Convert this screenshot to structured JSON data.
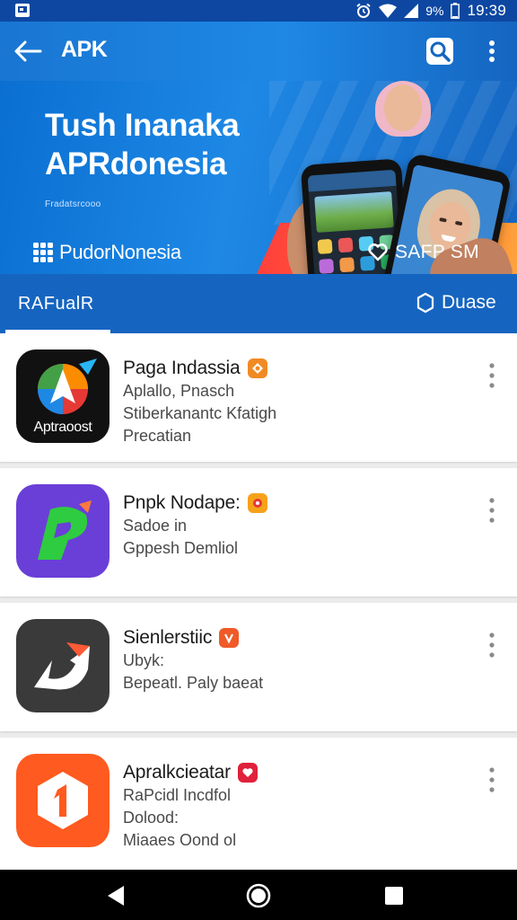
{
  "status_bar": {
    "battery": "9%",
    "time": "19:39"
  },
  "app_bar": {
    "title": "APK"
  },
  "banner": {
    "headline_line1": "Tush Inanaka",
    "headline_line2": "APRdonesia",
    "fine_print": "Fradatsrcooo",
    "brand": "PudorNonesia",
    "action": "SAFP SM"
  },
  "tabs": {
    "left": "RAFualR",
    "right": "Duase"
  },
  "apps": [
    {
      "name": "Paga Indassia",
      "icon_label": "Aptraoost",
      "line1": "Aplallo, Pnasch",
      "line2": "Stiberkanantc Kfatigh",
      "line3": "Precatian",
      "badge_color": "#f08a24"
    },
    {
      "name": "Pnpk Nodape:",
      "line1": "Sadoe in",
      "line2": "Gppesh Demliol",
      "line3": "",
      "badge_color": "#f6a21a"
    },
    {
      "name": "Sienlerstiic",
      "line1": "Ubyk:",
      "line2": "Bepeatl. Paly baeat",
      "line3": "",
      "badge_color": "#f05a28"
    },
    {
      "name": "Apralkcieatar",
      "line1": "RaPcidl Incdfol",
      "line2": "Dolood:",
      "line3": "Miaaes Oond ol",
      "badge_color": "#e0213b"
    }
  ],
  "colors": {
    "primary": "#1565c0",
    "accent": "#ff5a36"
  }
}
